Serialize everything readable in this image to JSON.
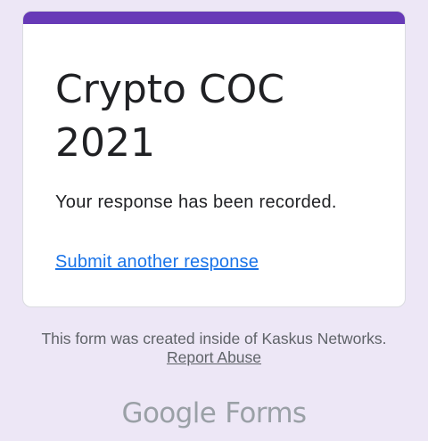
{
  "form": {
    "title": "Crypto COC 2021",
    "confirmation": "Your response has been recorded.",
    "submit_another_link": "Submit another response"
  },
  "footer": {
    "note_prefix": "This form was created inside of Kaskus Networks.",
    "report_abuse_link": "Report Abuse"
  },
  "brand": {
    "google": "Google",
    "forms": "Forms"
  },
  "colors": {
    "accent": "#673ab7",
    "background": "#ede7f6",
    "link": "#1a73e8"
  }
}
